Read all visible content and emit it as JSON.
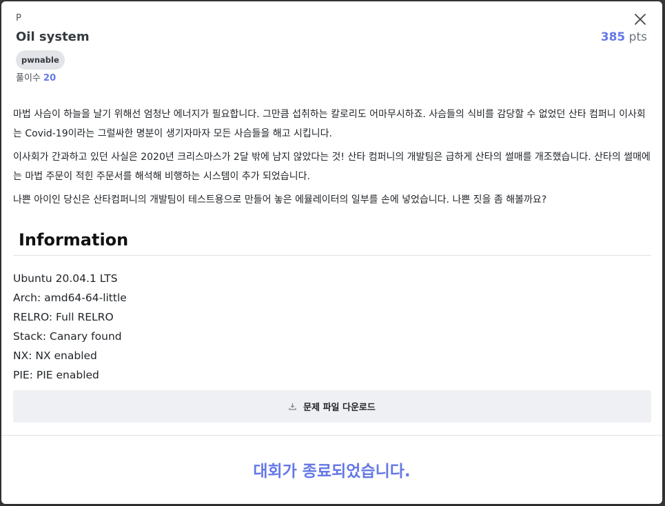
{
  "modal": {
    "category_letter": "P",
    "title": "Oil system",
    "points_value": "385",
    "points_unit": "pts",
    "tag": "pwnable",
    "solves_label": "풀이수",
    "solves_count": "20",
    "description": [
      "마법 사슴이 하늘을 날기 위해선 엄청난 에너지가 필요합니다. 그만큼 섭취하는 칼로리도 어마무시하죠. 사슴들의 식비를 감당할 수 없었던 산타 컴퍼니 이사회는 Covid-19이라는 그럴싸한 명분이 생기자마자 모든 사슴들을 해고 시킵니다.",
      "이사회가 간과하고 있던 사실은 2020년 크리스마스가 2달 밖에 남지 않았다는 것! 산타 컴퍼니의 개발팀은 급하게 산타의 썰매를 개조했습니다. 산타의 썰매에는 마법 주문이 적힌 주문서를 해석해 비행하는 시스템이 추가 되었습니다.",
      "나쁜 아이인 당신은 산타컴퍼니의 개발팀이 테스트용으로 만들어 놓은 에뮬레이터의 일부를 손에 넣었습니다. 나쁜 짓을 좀 해볼까요?"
    ],
    "info_heading": "Information",
    "info_lines": [
      "Ubuntu 20.04.1 LTS",
      "Arch: amd64-64-little",
      "RELRO: Full RELRO",
      "Stack: Canary found",
      "NX: NX enabled",
      "PIE: PIE enabled"
    ],
    "download_label": "문제 파일 다운로드",
    "ended_message": "대회가 종료되었습니다.",
    "accent_color": "#6478e6"
  }
}
